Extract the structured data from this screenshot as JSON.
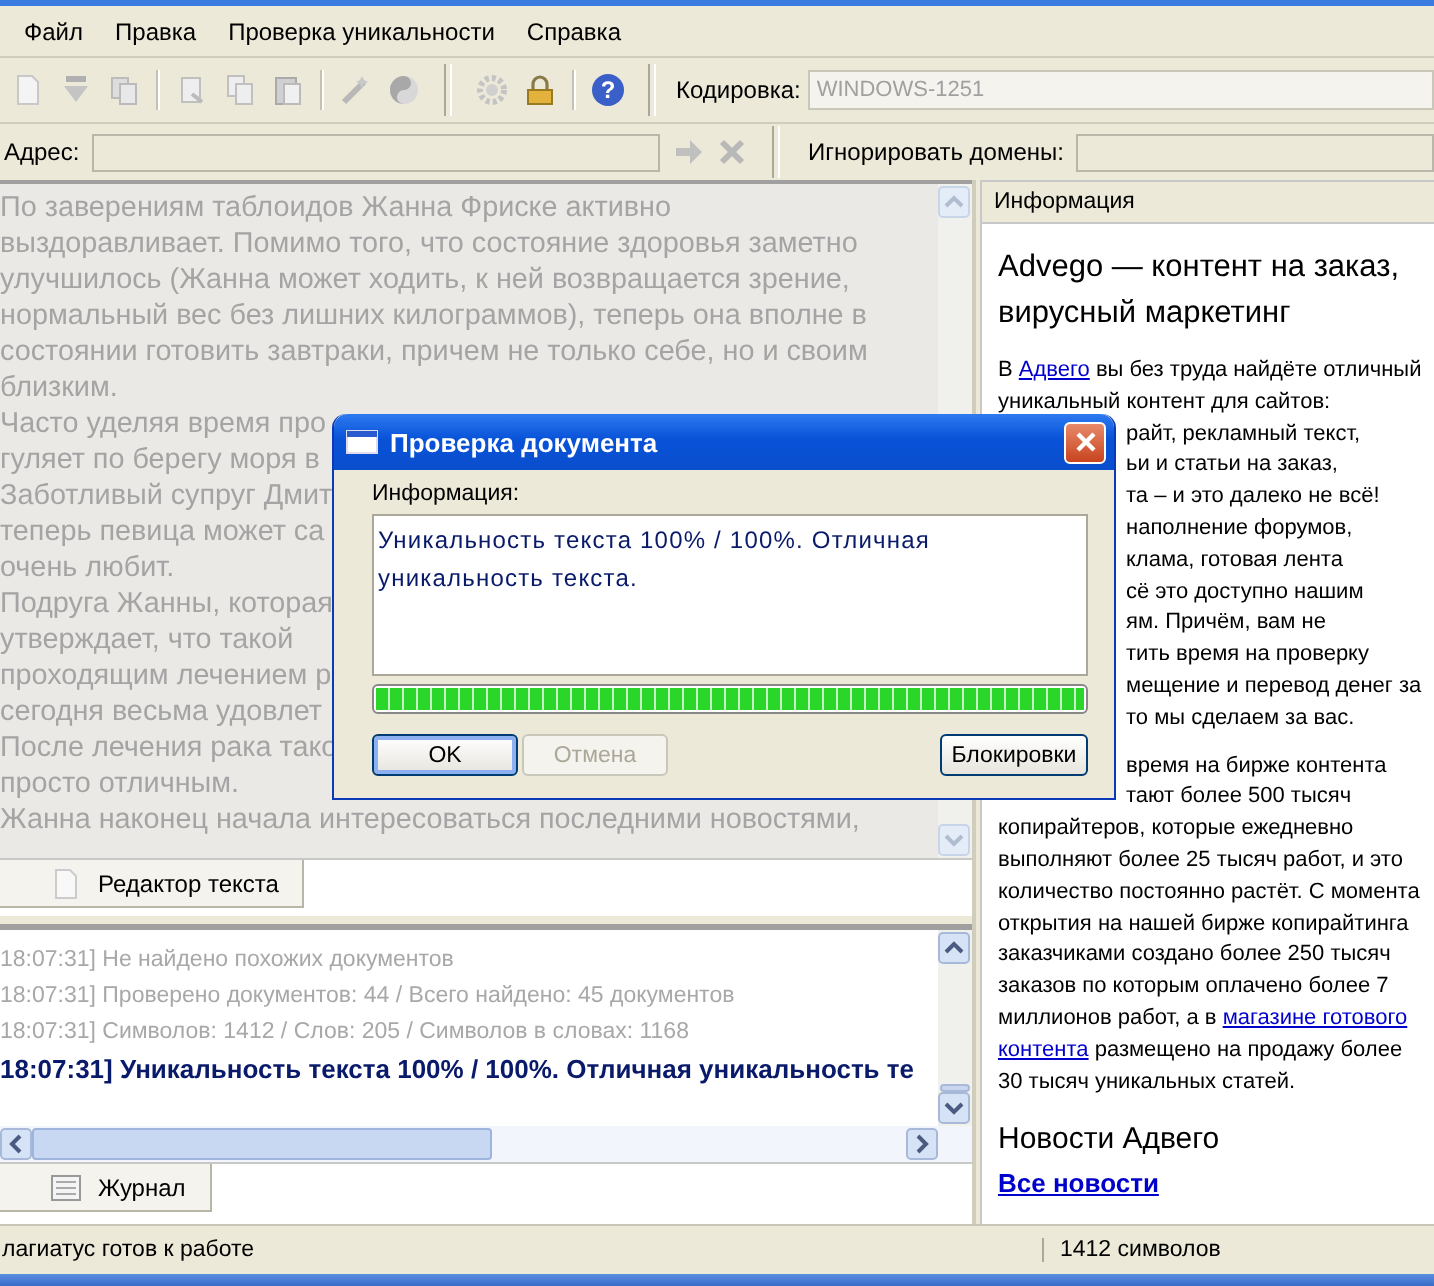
{
  "menu": [
    "Файл",
    "Правка",
    "Проверка уникальности",
    "Справка"
  ],
  "toolbar": {
    "help_glyph": "?",
    "encoding_label": "Кодировка:",
    "encoding_value": "WINDOWS-1251"
  },
  "address": {
    "label": "Адрес:",
    "ignore_label": "Игнорировать домены:"
  },
  "editor": {
    "lines": [
      "По заверениям таблоидов Жанна Фриске активно",
      "выздоравливает. Помимо того, что состояние здоровья заметно",
      "улучшилось (Жанна может ходить, к ней возвращается зрение,",
      "нормальный вес без лишних килограммов),  теперь она вполне в",
      "состоянии готовить завтраки, причем не только себе, но и своим",
      "близким.",
      "Часто уделяя время про",
      "гуляет по берегу моря в",
      "Заботливый супруг Дмит",
      "теперь певица может са",
      "очень любит.",
      "Подруга Жанны, которая",
      "утверждает, что такой",
      "проходящим лечением р",
      "сегодня весьма удовлет",
      "После лечения рака тако",
      "просто отличным.",
      "Жанна наконец начала интересоваться последними новостями,"
    ],
    "tab": "Редактор текста"
  },
  "log": {
    "lines": [
      {
        "kind": "info",
        "text": "18:07:31] Не найдено похожих документов"
      },
      {
        "kind": "info",
        "text": "18:07:31] Проверено документов: 44  / Всего найдено: 45 документов"
      },
      {
        "kind": "info",
        "text": "18:07:31] Символов: 1412 / Слов: 205 / Символов в словах: 1168"
      },
      {
        "kind": "result",
        "text": "18:07:31] Уникальность текста 100% / 100%. Отличная уникальность те"
      }
    ],
    "tab": "Журнал"
  },
  "info_panel": {
    "header": "Информация",
    "title": "Advego — контент на заказ, вирусный маркетинг",
    "paragraphs": [
      {
        "lines": [
          {
            "covered": false,
            "segments": [
              {
                "text": "В ",
                "link": false
              },
              {
                "text": "Адвего",
                "link": true
              },
              {
                "text": " вы без труда найдёте отличный",
                "link": false
              }
            ]
          },
          {
            "covered": false,
            "segments": [
              {
                "text": "уникальный контент для сайтов:",
                "link": false
              }
            ]
          },
          {
            "covered": true,
            "segments": [
              {
                "text": "райт, рекламный текст,",
                "link": false
              }
            ]
          },
          {
            "covered": true,
            "segments": [
              {
                "text": "ьи и статьи на заказ,",
                "link": false
              }
            ]
          },
          {
            "covered": true,
            "segments": [
              {
                "text": "та – и это далеко не всё!",
                "link": false
              }
            ]
          },
          {
            "covered": true,
            "segments": [
              {
                "text": "наполнение форумов,",
                "link": false
              }
            ]
          },
          {
            "covered": true,
            "segments": [
              {
                "text": "клама, готовая лента",
                "link": false
              }
            ]
          },
          {
            "covered": true,
            "segments": [
              {
                "text": "сё это доступно нашим",
                "link": false
              }
            ]
          },
          {
            "covered": true,
            "segments": [
              {
                "text": "ям. Причём, вам не",
                "link": false
              }
            ]
          },
          {
            "covered": true,
            "segments": [
              {
                "text": "тить время на проверку",
                "link": false
              }
            ]
          },
          {
            "covered": true,
            "segments": [
              {
                "text": "мещение и перевод денег за",
                "link": false
              }
            ]
          },
          {
            "covered": true,
            "segments": [
              {
                "text": "то мы сделаем за вас.",
                "link": false
              }
            ]
          }
        ]
      },
      {
        "lines": [
          {
            "covered": true,
            "segments": [
              {
                "text": "время на бирже контента",
                "link": false
              }
            ]
          },
          {
            "covered": true,
            "segments": [
              {
                "text": "тают более 500 тысяч",
                "link": false
              }
            ]
          },
          {
            "covered": false,
            "segments": [
              {
                "text": "копирайтеров, которые ежедневно",
                "link": false
              }
            ]
          },
          {
            "covered": false,
            "segments": [
              {
                "text": "выполняют более 25 тысяч работ, и это",
                "link": false
              }
            ]
          },
          {
            "covered": false,
            "segments": [
              {
                "text": "количество постоянно растёт. С момента",
                "link": false
              }
            ]
          },
          {
            "covered": false,
            "segments": [
              {
                "text": "открытия на нашей бирже копирайтинга",
                "link": false
              }
            ]
          },
          {
            "covered": false,
            "segments": [
              {
                "text": "заказчиками создано более 250 тысяч",
                "link": false
              }
            ]
          },
          {
            "covered": false,
            "segments": [
              {
                "text": "заказов по которым оплачено более 7",
                "link": false
              }
            ]
          },
          {
            "covered": false,
            "segments": [
              {
                "text": "миллионов работ, а в ",
                "link": false
              },
              {
                "text": "магазине готового",
                "link": true
              }
            ]
          },
          {
            "covered": false,
            "segments": [
              {
                "text": "контента",
                "link": true
              },
              {
                "text": " размещено на продажу более",
                "link": false
              }
            ]
          },
          {
            "covered": false,
            "segments": [
              {
                "text": "30 тысяч уникальных статей.",
                "link": false
              }
            ]
          }
        ]
      }
    ],
    "news_heading": "Новости Адвего",
    "news_link": "Все новости"
  },
  "status_bar": {
    "message": "лагиатус готов к работе",
    "chars": "1412 символов"
  },
  "dialog": {
    "title": "Проверка документа",
    "label": "Информация:",
    "message": "Уникальность текста 100% / 100%. Отличная уникальность текста.",
    "progress": {
      "level": 1
    },
    "buttons": [
      {
        "label": "OK",
        "default": true,
        "disabled": false
      },
      {
        "label": "Отмена",
        "default": false,
        "disabled": true
      },
      {
        "label": "Блокировки",
        "default": false,
        "disabled": false
      }
    ]
  }
}
